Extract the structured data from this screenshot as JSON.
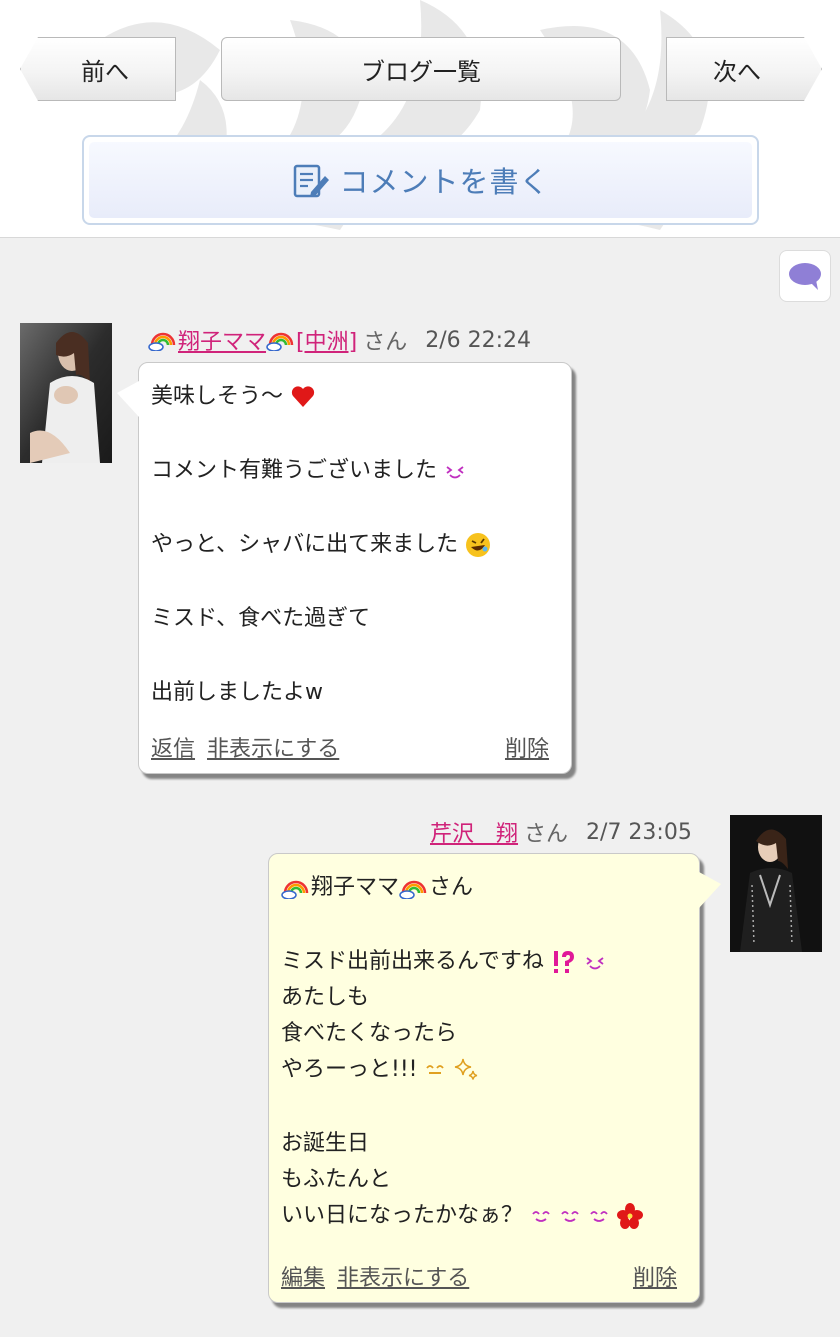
{
  "nav": {
    "prev_label": "前へ",
    "list_label": "ブログ一覧",
    "next_label": "次へ"
  },
  "write_comment": {
    "label": "コメントを書く"
  },
  "comments": [
    {
      "user_name": "翔子ママ",
      "location": "[中洲]",
      "san": "さん",
      "time": "2/6 22:24",
      "lines": [
        "美味しそう〜",
        "コメント有難うございました",
        "やっと、シャバに出て来ました",
        "ミスド、食べた過ぎて",
        "出前しましたよw"
      ],
      "actions": {
        "reply": "返信",
        "hide": "非表示にする",
        "delete": "削除"
      }
    },
    {
      "user_name": "芹沢　翔",
      "san": "さん",
      "time": "2/7 23:05",
      "lines": [
        "翔子ママ",
        "さん",
        "ミスド出前出来るんですね",
        "あたしも",
        "食べたくなったら",
        "やろーっと!!!",
        "お誕生日",
        "もふたんと",
        "いい日になったかなぁ？"
      ],
      "actions": {
        "edit": "編集",
        "hide": "非表示にする",
        "delete": "削除"
      }
    }
  ],
  "colors": {
    "username": "#d0237a",
    "comment_accent": "#4d7db8",
    "own_bubble": "#ffffe0",
    "other_bubble": "#ffffff"
  },
  "icons": [
    "pencil-note-icon",
    "speech-bubble-icon",
    "rainbow-cloud-icon",
    "heart-icon",
    "grin-face-icon",
    "rofl-face-icon",
    "interrobang-icon",
    "sparkle-icon",
    "hibiscus-icon"
  ]
}
